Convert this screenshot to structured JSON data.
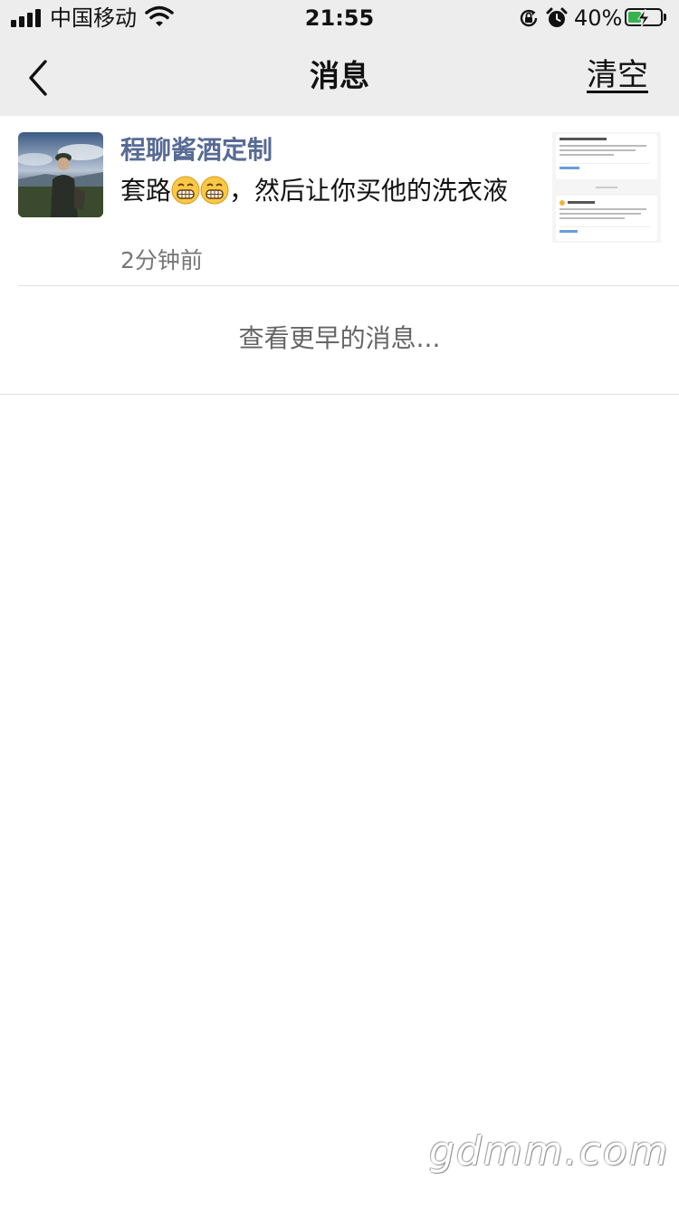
{
  "status_bar": {
    "carrier": "中国移动",
    "time": "21:55",
    "battery_percent": "40%",
    "battery_level": 0.4,
    "icons": [
      "signal-icon",
      "wifi-icon",
      "orientation-lock-icon",
      "alarm-icon",
      "battery-charging-icon"
    ]
  },
  "nav": {
    "title": "消息",
    "clear_label": "清空",
    "back_icon": "chevron-left-icon"
  },
  "messages": [
    {
      "sender": "程聊酱酒定制",
      "text_before": "套路",
      "emoji": [
        "grin-emoji",
        "grin-emoji"
      ],
      "text_after": "，然后让你买他的洗衣液",
      "time": "2分钟前",
      "avatar": "person-photo",
      "thumbnail": "chat-screenshot-thumbnail"
    }
  ],
  "more_label": "查看更早的消息...",
  "watermark": "gdmm.com",
  "colors": {
    "header_bg": "#ededed",
    "sender": "#576b95",
    "meta": "#777777",
    "battery_fill": "#37b24d"
  }
}
